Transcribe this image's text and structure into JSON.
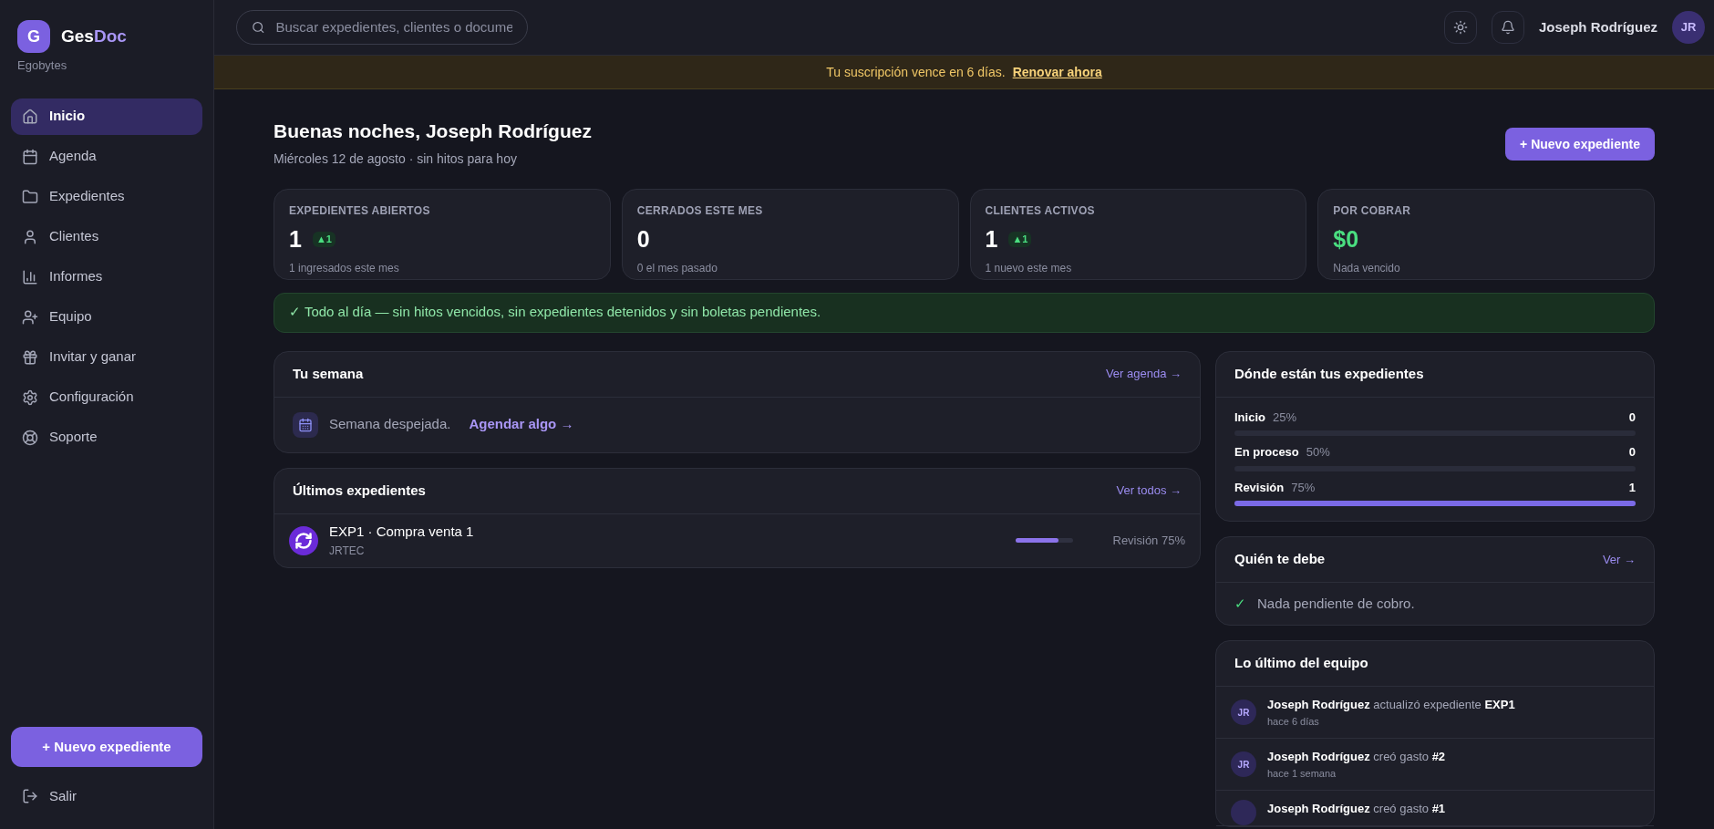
{
  "brand": {
    "initial": "G",
    "name_a": "Ges",
    "name_b": "Doc",
    "org": "Egobytes"
  },
  "sidebar": {
    "items": [
      {
        "label": "Inicio",
        "selected": true
      },
      {
        "label": "Agenda",
        "selected": false
      },
      {
        "label": "Expedientes",
        "selected": false
      },
      {
        "label": "Clientes",
        "selected": false
      },
      {
        "label": "Informes",
        "selected": false
      },
      {
        "label": "Equipo",
        "selected": false
      },
      {
        "label": "Invitar y ganar",
        "selected": false
      },
      {
        "label": "Configuración",
        "selected": false
      },
      {
        "label": "Soporte",
        "selected": false
      }
    ],
    "new_button": "+ Nuevo expediente",
    "logout": "Salir"
  },
  "topbar": {
    "search": {
      "placeholder": "Buscar expedientes, clientes o docume"
    },
    "user_name": "Joseph Rodríguez",
    "user_initials": "JR"
  },
  "banner": {
    "text": "Tu suscripción vence en 6 días.",
    "link": "Renovar ahora"
  },
  "header": {
    "title": "Buenas noches, Joseph Rodríguez",
    "subtitle": "Miércoles 12 de agosto · sin hitos para hoy",
    "button": "+ Nuevo expediente"
  },
  "stats": [
    {
      "kind": "count",
      "label": "EXPEDIENTES ABIERTOS",
      "value": "1",
      "delta": "▲1",
      "sub": "1 ingresados este mes"
    },
    {
      "kind": "count",
      "label": "CERRADOS ESTE MES",
      "value": "0",
      "sub": "0 el mes pasado"
    },
    {
      "kind": "count",
      "label": "CLIENTES ACTIVOS",
      "value": "1",
      "delta": "▲1",
      "sub": "1 nuevo este mes"
    },
    {
      "kind": "money",
      "label": "POR COBRAR",
      "value": "$0",
      "sub": "Nada vencido"
    }
  ],
  "alert": "✓ Todo al día — sin hitos vencidos, sin expedientes detenidos y sin boletas pendientes.",
  "week": {
    "title": "Tu semana",
    "link": "Ver agenda →",
    "empty": "Semana despejada.",
    "action": "Agendar algo →"
  },
  "recent": {
    "title": "Últimos expedientes",
    "link": "Ver todos →",
    "rows": [
      {
        "title": "EXP1 · Compra venta 1",
        "client": "JRTEC",
        "level": 0.75,
        "status": "Revisión 75%"
      }
    ]
  },
  "stages": {
    "title": "Dónde están tus expedientes",
    "rows": [
      {
        "name": "Inicio",
        "pct": "25%",
        "count": "0",
        "level": 0
      },
      {
        "name": "En proceso",
        "pct": "50%",
        "count": "0",
        "level": 0
      },
      {
        "name": "Revisión",
        "pct": "75%",
        "count": "1",
        "level": 1
      }
    ]
  },
  "debts": {
    "title": "Quién te debe",
    "link": "Ver →",
    "check": "✓",
    "empty": "Nada pendiente de cobro."
  },
  "team": {
    "title": "Lo último del equipo",
    "items": [
      {
        "initials": "JR",
        "text": "**Joseph Rodríguez** actualizó expediente **EXP1**",
        "time": "hace 6 días"
      },
      {
        "initials": "JR",
        "text": "**Joseph Rodríguez** creó gasto **#2**",
        "time": "hace 1 semana"
      },
      {
        "text": "**Joseph Rodríguez** creó gasto **#1**"
      }
    ]
  }
}
